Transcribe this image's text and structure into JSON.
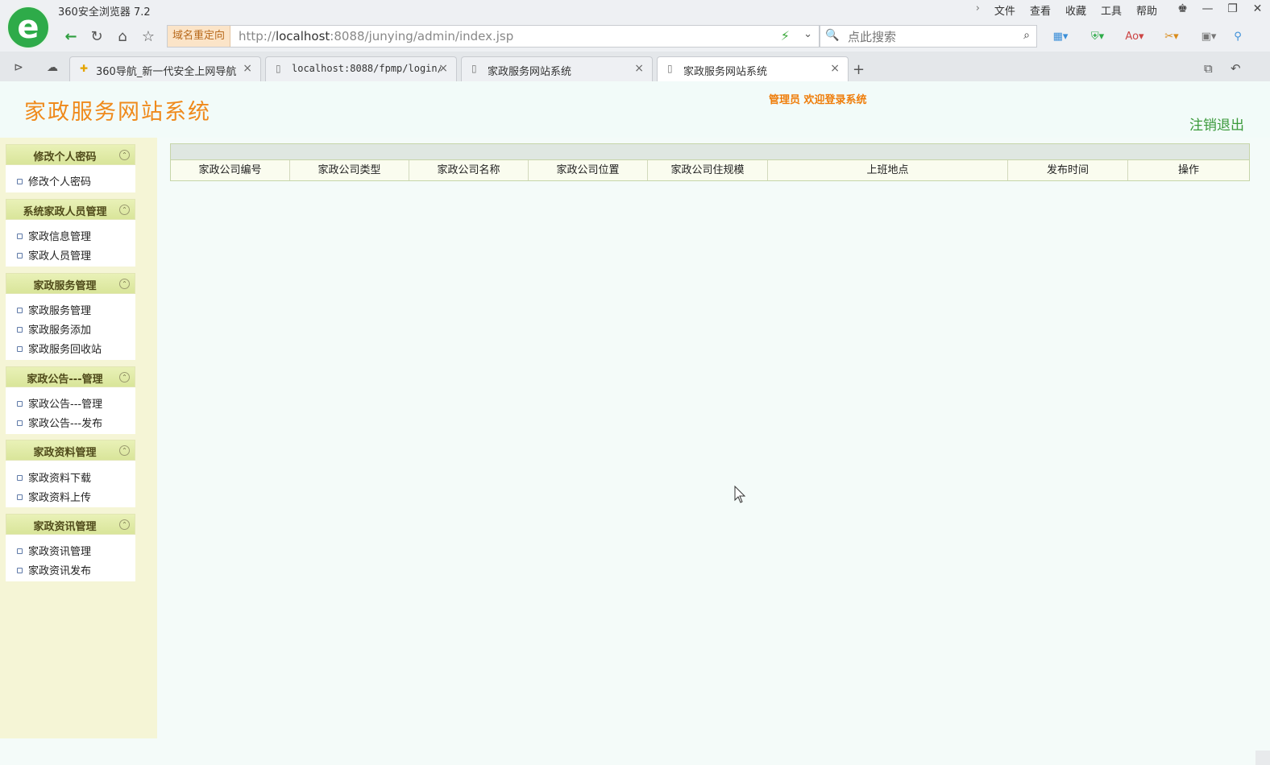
{
  "browser": {
    "app_title": "360安全浏览器 7.2",
    "menu": [
      "文件",
      "查看",
      "收藏",
      "工具",
      "帮助"
    ],
    "redirect_badge": "域名重定向",
    "url_prefix": "http://",
    "url_host": "localhost",
    "url_rest": ":8088/junying/admin/index.jsp",
    "search_placeholder": "点此搜索",
    "tabs": [
      {
        "label": "360导航_新一代安全上网导航"
      },
      {
        "label": "localhost:8088/fpmp/login/"
      },
      {
        "label": "家政服务网站系统"
      },
      {
        "label": "家政服务网站系统"
      }
    ]
  },
  "header": {
    "site_title": "家政服务网站系统",
    "welcome": "管理员  欢迎登录系统",
    "logout": "注销退出"
  },
  "sidebar": {
    "groups": [
      {
        "title": "修改个人密码",
        "items": [
          "修改个人密码"
        ]
      },
      {
        "title": "系统家政人员管理",
        "items": [
          "家政信息管理",
          "家政人员管理"
        ]
      },
      {
        "title": "家政服务管理",
        "items": [
          "家政服务管理",
          "家政服务添加",
          "家政服务回收站"
        ]
      },
      {
        "title": "家政公告---管理",
        "items": [
          "家政公告---管理",
          "家政公告---发布"
        ]
      },
      {
        "title": "家政资料管理",
        "items": [
          "家政资料下载",
          "家政资料上传"
        ]
      },
      {
        "title": "家政资讯管理",
        "items": [
          "家政资讯管理",
          "家政资讯发布"
        ]
      }
    ]
  },
  "table": {
    "columns": [
      "家政公司编号",
      "家政公司类型",
      "家政公司名称",
      "家政公司位置",
      "家政公司住规模",
      "上班地点",
      "发布时间",
      "操作"
    ],
    "rows": []
  }
}
